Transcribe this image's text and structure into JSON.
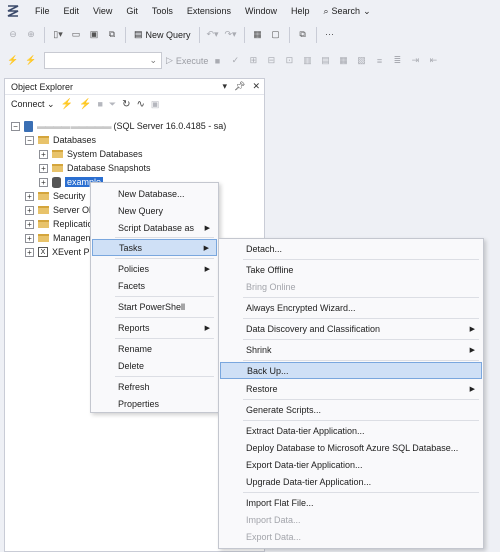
{
  "menubar": {
    "items": [
      "File",
      "Edit",
      "View",
      "Git",
      "Tools",
      "Extensions",
      "Window",
      "Help"
    ],
    "search_label": "Search"
  },
  "toolbar": {
    "new_query_label": "New Query",
    "execute_label": "Execute"
  },
  "object_explorer": {
    "title": "Object Explorer",
    "connect_label": "Connect",
    "server": {
      "name_redacted": "▬▬▬▬ ▬▬▬▬▬",
      "info": "(SQL Server 16.0.4185 - sa)"
    },
    "tree": {
      "databases": "Databases",
      "system_databases": "System Databases",
      "database_snapshots": "Database Snapshots",
      "selected_db": "example",
      "security": "Security",
      "server_objects": "Server Ob",
      "replication": "Replicatio",
      "management": "Managen",
      "xevent": "XEvent Pr"
    }
  },
  "context_menu": {
    "items": [
      {
        "label": "New Database...",
        "submenu": false
      },
      {
        "label": "New Query",
        "submenu": false
      },
      {
        "label": "Script Database as",
        "submenu": true
      },
      {
        "label": "Tasks",
        "submenu": true,
        "highlighted": true
      },
      {
        "label": "Policies",
        "submenu": true
      },
      {
        "label": "Facets",
        "submenu": false
      },
      {
        "label": "Start PowerShell",
        "submenu": false
      },
      {
        "label": "Reports",
        "submenu": true
      },
      {
        "label": "Rename",
        "submenu": false
      },
      {
        "label": "Delete",
        "submenu": false
      },
      {
        "label": "Refresh",
        "submenu": false
      },
      {
        "label": "Properties",
        "submenu": false
      }
    ]
  },
  "tasks_submenu": {
    "items": [
      {
        "label": "Detach...",
        "submenu": false,
        "enabled": true
      },
      {
        "label": "Take Offline",
        "submenu": false,
        "enabled": true
      },
      {
        "label": "Bring Online",
        "submenu": false,
        "enabled": false
      },
      {
        "label": "Always Encrypted Wizard...",
        "submenu": false,
        "enabled": true
      },
      {
        "label": "Data Discovery and Classification",
        "submenu": true,
        "enabled": true
      },
      {
        "label": "Shrink",
        "submenu": true,
        "enabled": true
      },
      {
        "label": "Back Up...",
        "submenu": false,
        "enabled": true,
        "highlighted": true
      },
      {
        "label": "Restore",
        "submenu": true,
        "enabled": true
      },
      {
        "label": "Generate Scripts...",
        "submenu": false,
        "enabled": true
      },
      {
        "label": "Extract Data-tier Application...",
        "submenu": false,
        "enabled": true
      },
      {
        "label": "Deploy Database to Microsoft Azure SQL Database...",
        "submenu": false,
        "enabled": true
      },
      {
        "label": "Export Data-tier Application...",
        "submenu": false,
        "enabled": true
      },
      {
        "label": "Upgrade Data-tier Application...",
        "submenu": false,
        "enabled": true
      },
      {
        "label": "Import Flat File...",
        "submenu": false,
        "enabled": true
      },
      {
        "label": "Import Data...",
        "submenu": false,
        "enabled": false
      },
      {
        "label": "Export Data...",
        "submenu": false,
        "enabled": false
      }
    ]
  },
  "colors": {
    "selection": "#2b6fd1",
    "menu_highlight": "#cfe0f6",
    "folder": "#e8c36b"
  }
}
